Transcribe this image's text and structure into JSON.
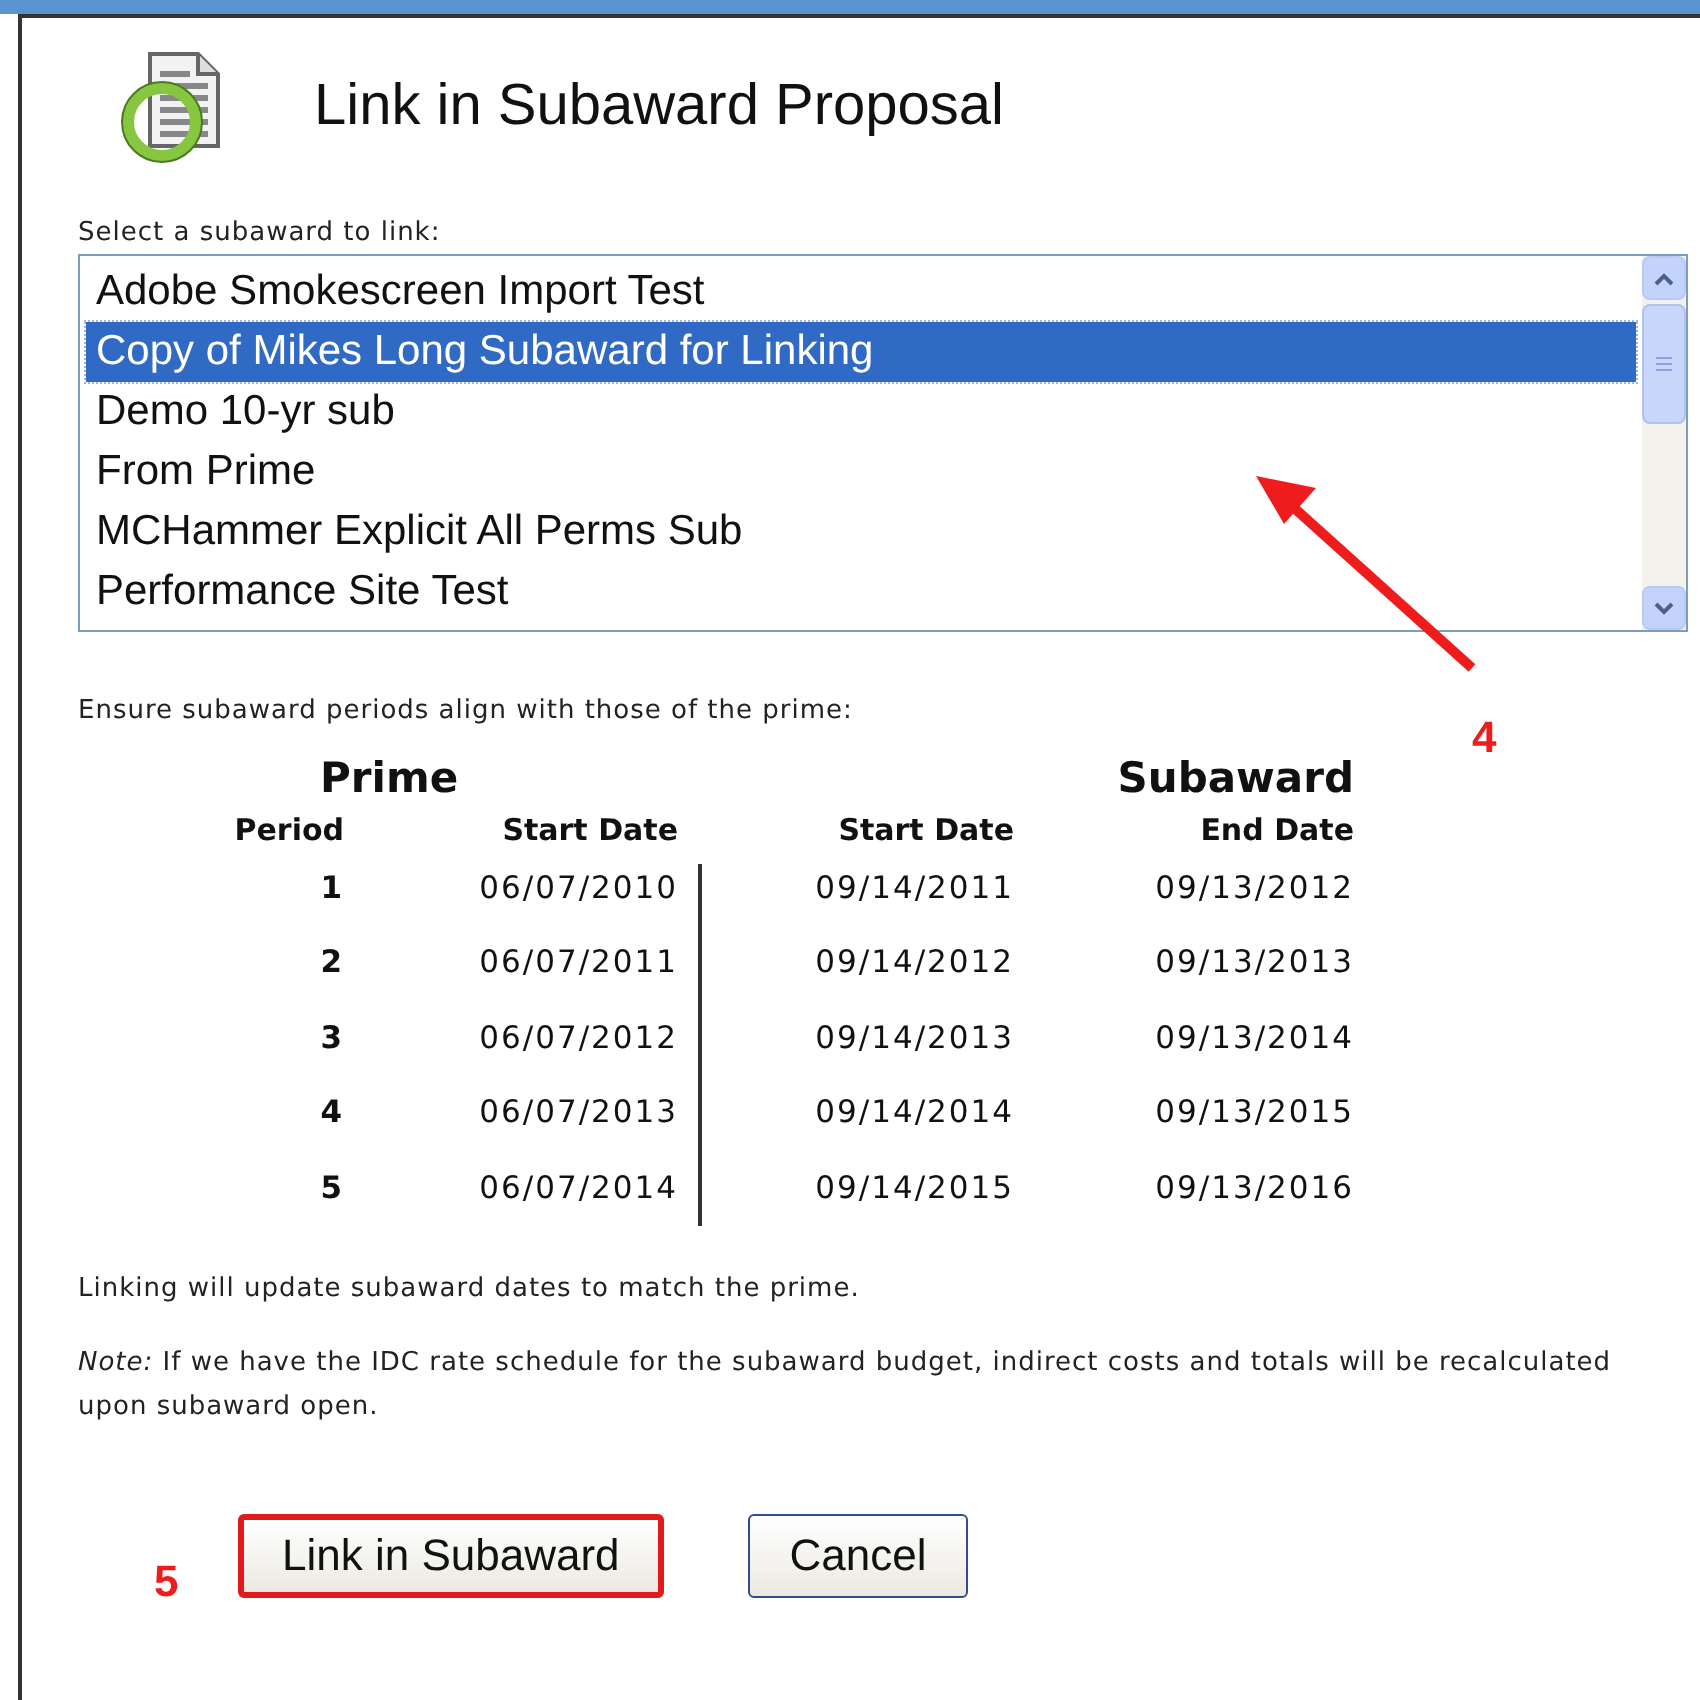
{
  "dialog": {
    "title": "Link in Subaward Proposal"
  },
  "list_label": "Select a subaward to link:",
  "subawards": [
    {
      "label": "Adobe Smokescreen Import Test",
      "selected": false
    },
    {
      "label": "Copy of Mikes Long Subaward for Linking",
      "selected": true
    },
    {
      "label": "Demo 10-yr sub",
      "selected": false
    },
    {
      "label": "From Prime",
      "selected": false
    },
    {
      "label": "MCHammer Explicit All Perms Sub",
      "selected": false
    },
    {
      "label": "Performance Site Test",
      "selected": false
    }
  ],
  "periods_intro": "Ensure subaward periods align with those of the prime:",
  "periods_table": {
    "group_headers": [
      "Prime",
      "Subaward"
    ],
    "columns": [
      "Period",
      "Start Date",
      "Start Date",
      "End Date"
    ],
    "rows": [
      [
        "1",
        "06/07/2010",
        "09/14/2011",
        "09/13/2012"
      ],
      [
        "2",
        "06/07/2011",
        "09/14/2012",
        "09/13/2013"
      ],
      [
        "3",
        "06/07/2012",
        "09/14/2013",
        "09/13/2014"
      ],
      [
        "4",
        "06/07/2013",
        "09/14/2014",
        "09/13/2015"
      ],
      [
        "5",
        "06/07/2014",
        "09/14/2015",
        "09/13/2016"
      ]
    ]
  },
  "info_text": "Linking will update subaward dates to match the prime.",
  "note": "*Note:* If we have the IDC rate schedule for the subaward budget, indirect costs and totals will be recalculated upon subaward open.",
  "buttons": [
    {
      "label": "Link in Subaward",
      "highlighted": true
    },
    {
      "label": "Cancel",
      "highlighted": false
    }
  ],
  "callouts": [
    {
      "label": "4"
    },
    {
      "label": "5"
    }
  ]
}
